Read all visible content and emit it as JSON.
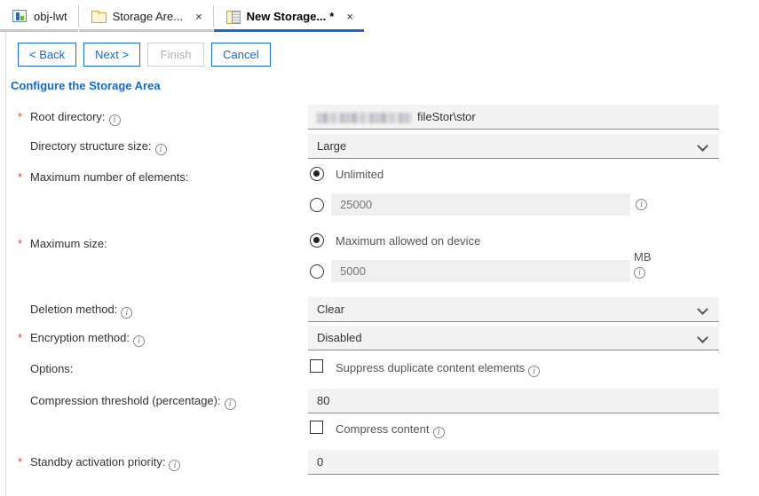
{
  "tabs": [
    {
      "label": "obj-lwt",
      "icon": "chart-icon",
      "active": false,
      "dirty": false,
      "closable": false
    },
    {
      "label": "Storage Are...",
      "icon": "folder-icon",
      "active": false,
      "dirty": false,
      "closable": true,
      "close_label": "×"
    },
    {
      "label": "New Storage...",
      "icon": "document-icon",
      "active": true,
      "dirty": true,
      "dirty_marker": "*",
      "closable": true,
      "close_label": "×"
    }
  ],
  "toolbar": {
    "back_label": "< Back",
    "next_label": "Next >",
    "finish_label": "Finish",
    "cancel_label": "Cancel"
  },
  "section": {
    "title": "Configure the Storage Area"
  },
  "colors": {
    "accent": "#1569c7",
    "required_asterisk": "#e8432d",
    "field_background": "#f3f3f3",
    "field_underline": "#8a8a8a",
    "disabled_text": "#b3b3b3"
  },
  "form": {
    "required_marker": "*",
    "info_glyph": "i",
    "rows": {
      "root_directory": {
        "label": "Root directory:",
        "required": true,
        "has_info": true,
        "value_redacted": true,
        "value_visible_suffix": "fileStor\\stor"
      },
      "directory_structure_size": {
        "label": "Directory structure size:",
        "required": false,
        "has_info": true,
        "value": "Large",
        "control": "dropdown"
      },
      "maximum_number_of_elements": {
        "label": "Maximum number of elements:",
        "required": true,
        "has_info": false,
        "option_unlimited_label": "Unlimited",
        "option_unlimited_selected": true,
        "option_value_selected": false,
        "value_placeholder": "25000",
        "value_has_info": true
      },
      "maximum_size": {
        "label": "Maximum size:",
        "required": true,
        "has_info": false,
        "option_device_label": "Maximum allowed on device",
        "option_device_selected": true,
        "option_value_selected": false,
        "value_placeholder": "5000",
        "unit": "MB",
        "value_has_info": true
      },
      "deletion_method": {
        "label": "Deletion method:",
        "required": false,
        "has_info": true,
        "value": "Clear",
        "control": "dropdown"
      },
      "encryption_method": {
        "label": "Encryption method:",
        "required": true,
        "has_info": true,
        "value": "Disabled",
        "control": "dropdown"
      },
      "options": {
        "label": "Options:",
        "required": false,
        "has_info": false,
        "suppress_duplicate_label": "Suppress duplicate content elements",
        "suppress_duplicate_checked": false,
        "suppress_duplicate_has_info": true
      },
      "compression_threshold": {
        "label": "Compression threshold (percentage):",
        "required": false,
        "has_info": true,
        "value": "80"
      },
      "compress_content": {
        "label": "Compress content",
        "checked": false,
        "has_info": true
      },
      "standby_activation_priority": {
        "label": "Standby activation priority:",
        "required": true,
        "has_info": true,
        "value": "0"
      }
    }
  }
}
